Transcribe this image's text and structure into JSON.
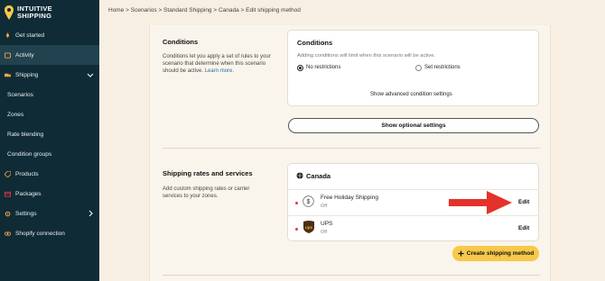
{
  "brand": {
    "line1": "INTUITIVE",
    "line2": "SHIPPING"
  },
  "sidebar": {
    "items": [
      {
        "label": "Get started",
        "icon": "rocket-icon"
      },
      {
        "label": "Activity",
        "icon": "activity-icon",
        "active": true
      },
      {
        "label": "Shipping",
        "icon": "truck-icon",
        "expanded": true
      },
      {
        "label": "Scenarios",
        "sub": true
      },
      {
        "label": "Zones",
        "sub": true
      },
      {
        "label": "Rate blending",
        "sub": true
      },
      {
        "label": "Condition groups",
        "sub": true
      },
      {
        "label": "Products",
        "icon": "tag-icon"
      },
      {
        "label": "Packages",
        "icon": "package-icon"
      },
      {
        "label": "Settings",
        "icon": "gear-icon"
      },
      {
        "label": "Shopify connection",
        "icon": "link-icon"
      }
    ]
  },
  "breadcrumb": "Home > Scenarios > Standard Shipping > Canada > Edit shipping method",
  "conditions": {
    "title": "Conditions",
    "desc": "Conditions let you apply a set of rules to your scenario that determine when this scenario should be active.",
    "learn_more": "Learn more.",
    "card_title": "Conditions",
    "card_sub": "Adding conditions will limit when this scenario will be active.",
    "option_no": "No restrictions",
    "option_set": "Set restrictions",
    "advanced_link": "Show advanced condition settings"
  },
  "optional_button": "Show optional settings",
  "rates": {
    "title": "Shipping rates and services",
    "desc": "Add custom shipping rates or carrier services to your zones.",
    "zone": "Canada",
    "rows": [
      {
        "name": "Free Holiday Shipping",
        "status": "Off",
        "edit": "Edit"
      },
      {
        "name": "UPS",
        "status": "Off",
        "edit": "Edit"
      }
    ],
    "create_button": "Create shipping method"
  },
  "colors": {
    "sidebar": "#0f2b36",
    "accent_yellow": "#f7c84a",
    "arrow_red": "#e4322a"
  }
}
